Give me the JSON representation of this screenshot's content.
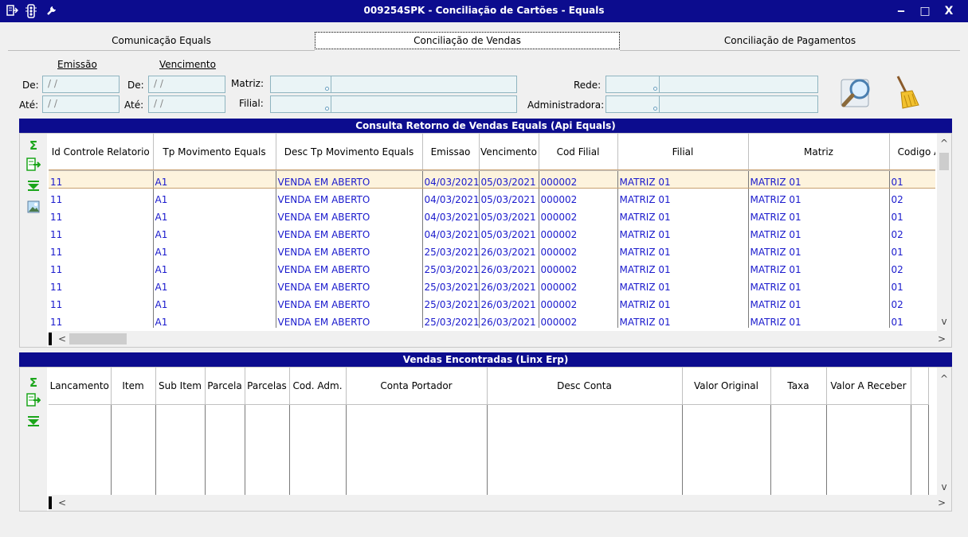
{
  "window": {
    "title": "009254SPK - Conciliação de Cartões - Equals",
    "icons": [
      "menu-icon",
      "traffic-light-icon",
      "wrench-icon"
    ],
    "minimize_label": "‒",
    "maximize_label": "□",
    "close_label": "X"
  },
  "tabs": [
    {
      "label": "Comunicação Equals",
      "active": false
    },
    {
      "label": "Conciliação de Vendas",
      "active": true
    },
    {
      "label": "Conciliação de Pagamentos",
      "active": false
    }
  ],
  "filters": {
    "emissao_label": "Emissão",
    "vencimento_label": "Vencimento",
    "de_label": "De:",
    "ate_label": "Até:",
    "date_placeholder": "/ /",
    "matriz_label": "Matriz:",
    "filial_label": "Filial:",
    "rede_label": "Rede:",
    "administradora_label": "Administradora:"
  },
  "actions": {
    "search_icon": "magnifier-icon",
    "clear_icon": "broom-icon"
  },
  "top_panel": {
    "title": "Consulta Retorno de Vendas Equals (Api Equals)",
    "columns": [
      "Id Controle Relatorio",
      "Tp Movimento Equals",
      "Desc Tp Movimento Equals",
      "Emissao",
      "Vencimento",
      "Cod Filial",
      "Filial",
      "Matriz",
      "Codigo A"
    ],
    "rows": [
      [
        "11",
        "A1",
        "VENDA EM ABERTO",
        "04/03/2021",
        "05/03/2021",
        "000002",
        "MATRIZ 01",
        "MATRIZ 01",
        "01"
      ],
      [
        "11",
        "A1",
        "VENDA EM ABERTO",
        "04/03/2021",
        "05/03/2021",
        "000002",
        "MATRIZ 01",
        "MATRIZ 01",
        "02"
      ],
      [
        "11",
        "A1",
        "VENDA EM ABERTO",
        "04/03/2021",
        "05/03/2021",
        "000002",
        "MATRIZ 01",
        "MATRIZ 01",
        "01"
      ],
      [
        "11",
        "A1",
        "VENDA EM ABERTO",
        "04/03/2021",
        "05/03/2021",
        "000002",
        "MATRIZ 01",
        "MATRIZ 01",
        "02"
      ],
      [
        "11",
        "A1",
        "VENDA EM ABERTO",
        "25/03/2021",
        "26/03/2021",
        "000002",
        "MATRIZ 01",
        "MATRIZ 01",
        "01"
      ],
      [
        "11",
        "A1",
        "VENDA EM ABERTO",
        "25/03/2021",
        "26/03/2021",
        "000002",
        "MATRIZ 01",
        "MATRIZ 01",
        "02"
      ],
      [
        "11",
        "A1",
        "VENDA EM ABERTO",
        "25/03/2021",
        "26/03/2021",
        "000002",
        "MATRIZ 01",
        "MATRIZ 01",
        "01"
      ],
      [
        "11",
        "A1",
        "VENDA EM ABERTO",
        "25/03/2021",
        "26/03/2021",
        "000002",
        "MATRIZ 01",
        "MATRIZ 01",
        "02"
      ],
      [
        "11",
        "A1",
        "VENDA EM ABERTO",
        "25/03/2021",
        "26/03/2021",
        "000002",
        "MATRIZ 01",
        "MATRIZ 01",
        "01"
      ]
    ],
    "tool_icons": [
      "sum-icon",
      "export-icon",
      "filter-down-icon",
      "image-icon"
    ]
  },
  "bottom_panel": {
    "title": "Vendas Encontradas (Linx Erp)",
    "columns": [
      "Lancamento",
      "Item",
      "Sub Item",
      "Parcela",
      "Parcelas",
      "Cod. Adm.",
      "Conta Portador",
      "Desc Conta",
      "Valor Original",
      "Taxa",
      "Valor A Receber"
    ],
    "tool_icons": [
      "sum-icon",
      "export-icon",
      "filter-down-icon"
    ]
  },
  "scroll": {
    "up": "^",
    "down": "v",
    "left": "<",
    "right": ">"
  },
  "colors": {
    "titlebar": "#0c0c8e",
    "cell_text": "#1a1acd",
    "selected_row": "#fdf3dd",
    "input_bg": "#eaf4f6"
  }
}
